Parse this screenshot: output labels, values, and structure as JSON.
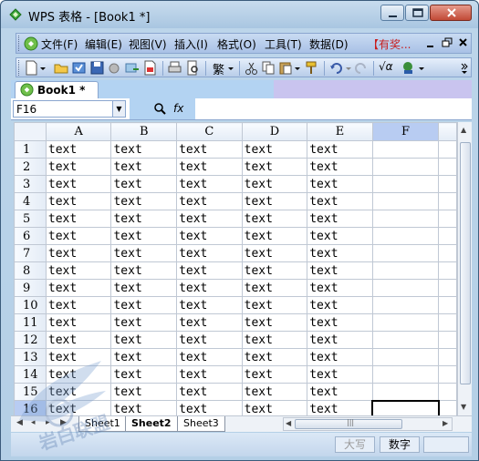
{
  "window": {
    "title": "WPS 表格 - [Book1 *]"
  },
  "menubar": {
    "items": [
      "文件(F)",
      "编辑(E)",
      "视图(V)",
      "插入(I)",
      "格式(O)",
      "工具(T)",
      "数据(D)"
    ],
    "promo": "【有奖...",
    "mdi_min": "▁",
    "mdi_restore": "🗗",
    "mdi_close": "✕"
  },
  "toolbar": {
    "traditional_label": "繁",
    "formula_label": "√α"
  },
  "doc_tabs": [
    {
      "label": "Book1  *"
    }
  ],
  "formula_bar": {
    "cell_ref": "F16",
    "fx_label": "fx",
    "formula_value": ""
  },
  "grid": {
    "columns": [
      "A",
      "B",
      "C",
      "D",
      "E",
      "F"
    ],
    "active_column": "F",
    "active_row": 16,
    "selected_cell": "F16",
    "rows": [
      {
        "num": "1",
        "cells": [
          "text",
          "text",
          "text",
          "text",
          "text",
          ""
        ]
      },
      {
        "num": "2",
        "cells": [
          "text",
          "text",
          "text",
          "text",
          "text",
          ""
        ]
      },
      {
        "num": "3",
        "cells": [
          "text",
          "text",
          "text",
          "text",
          "text",
          ""
        ]
      },
      {
        "num": "4",
        "cells": [
          "text",
          "text",
          "text",
          "text",
          "text",
          ""
        ]
      },
      {
        "num": "5",
        "cells": [
          "text",
          "text",
          "text",
          "text",
          "text",
          ""
        ]
      },
      {
        "num": "6",
        "cells": [
          "text",
          "text",
          "text",
          "text",
          "text",
          ""
        ]
      },
      {
        "num": "7",
        "cells": [
          "text",
          "text",
          "text",
          "text",
          "text",
          ""
        ]
      },
      {
        "num": "8",
        "cells": [
          "text",
          "text",
          "text",
          "text",
          "text",
          ""
        ]
      },
      {
        "num": "9",
        "cells": [
          "text",
          "text",
          "text",
          "text",
          "text",
          ""
        ]
      },
      {
        "num": "10",
        "cells": [
          "text",
          "text",
          "text",
          "text",
          "text",
          ""
        ]
      },
      {
        "num": "11",
        "cells": [
          "text",
          "text",
          "text",
          "text",
          "text",
          ""
        ]
      },
      {
        "num": "12",
        "cells": [
          "text",
          "text",
          "text",
          "text",
          "text",
          ""
        ]
      },
      {
        "num": "13",
        "cells": [
          "text",
          "text",
          "text",
          "text",
          "text",
          ""
        ]
      },
      {
        "num": "14",
        "cells": [
          "text",
          "text",
          "text",
          "text",
          "text",
          ""
        ]
      },
      {
        "num": "15",
        "cells": [
          "text",
          "text",
          "text",
          "text",
          "text",
          ""
        ]
      },
      {
        "num": "16",
        "cells": [
          "text",
          "text",
          "text",
          "text",
          "text",
          ""
        ]
      }
    ]
  },
  "sheet_tabs": {
    "tabs": [
      "Sheet1",
      "Sheet2",
      "Sheet3"
    ],
    "active": "Sheet2"
  },
  "statusbar": {
    "caps": "大写",
    "num": "数字"
  },
  "watermark": {
    "text": "岩白联盟"
  },
  "colors": {
    "titlebar": "#a9c6e1",
    "menubar": "#b8cdeb",
    "promo": "#c81d1d",
    "active_header": "#b8ccf2",
    "tabstrip_right": "#c9c4ef"
  }
}
